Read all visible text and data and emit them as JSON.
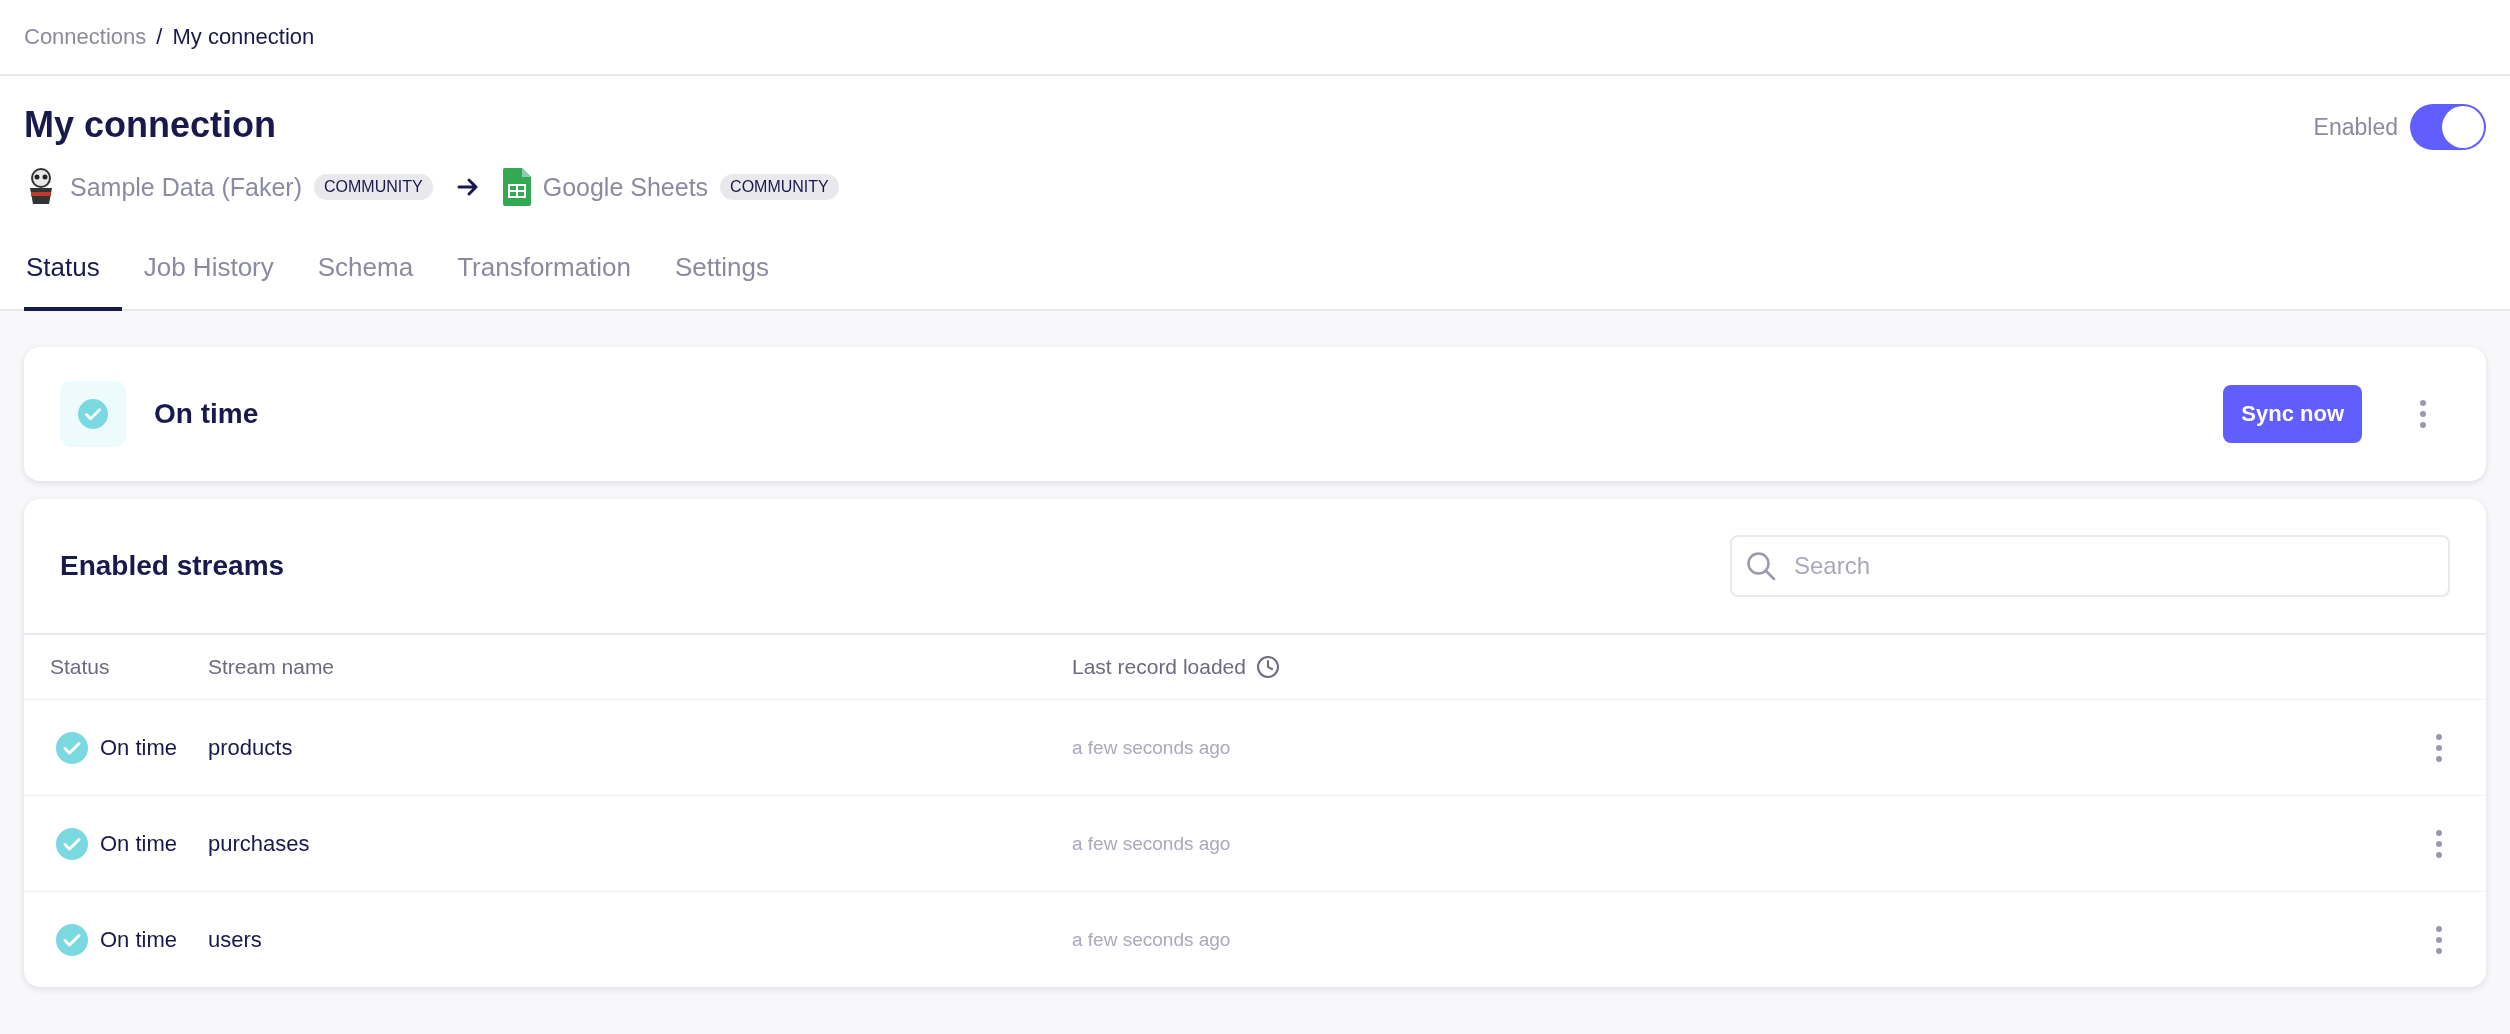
{
  "breadcrumb": [
    {
      "label": "Connections",
      "current": false
    },
    {
      "label": "My connection",
      "current": true
    }
  ],
  "breadcrumb_separator": "/",
  "title": "My connection",
  "enabled": {
    "label": "Enabled",
    "on": true
  },
  "source": {
    "name": "Sample Data (Faker)",
    "badge": "COMMUNITY"
  },
  "destination": {
    "name": "Google Sheets",
    "badge": "COMMUNITY"
  },
  "tabs": [
    {
      "label": "Status",
      "selected": true
    },
    {
      "label": "Job History",
      "selected": false
    },
    {
      "label": "Schema",
      "selected": false
    },
    {
      "label": "Transformation",
      "selected": false
    },
    {
      "label": "Settings",
      "selected": false
    }
  ],
  "status_card": {
    "status": "On time",
    "button": "Sync now"
  },
  "streams": {
    "title": "Enabled streams",
    "search": {
      "placeholder": "Search"
    },
    "columns": [
      "Status",
      "Stream name",
      "Last record loaded"
    ],
    "rows": [
      {
        "status": "On time",
        "name": "products",
        "last": "a few seconds ago"
      },
      {
        "status": "On time",
        "name": "purchases",
        "last": "a few seconds ago"
      },
      {
        "status": "On time",
        "name": "users",
        "last": "a few seconds ago"
      }
    ]
  }
}
